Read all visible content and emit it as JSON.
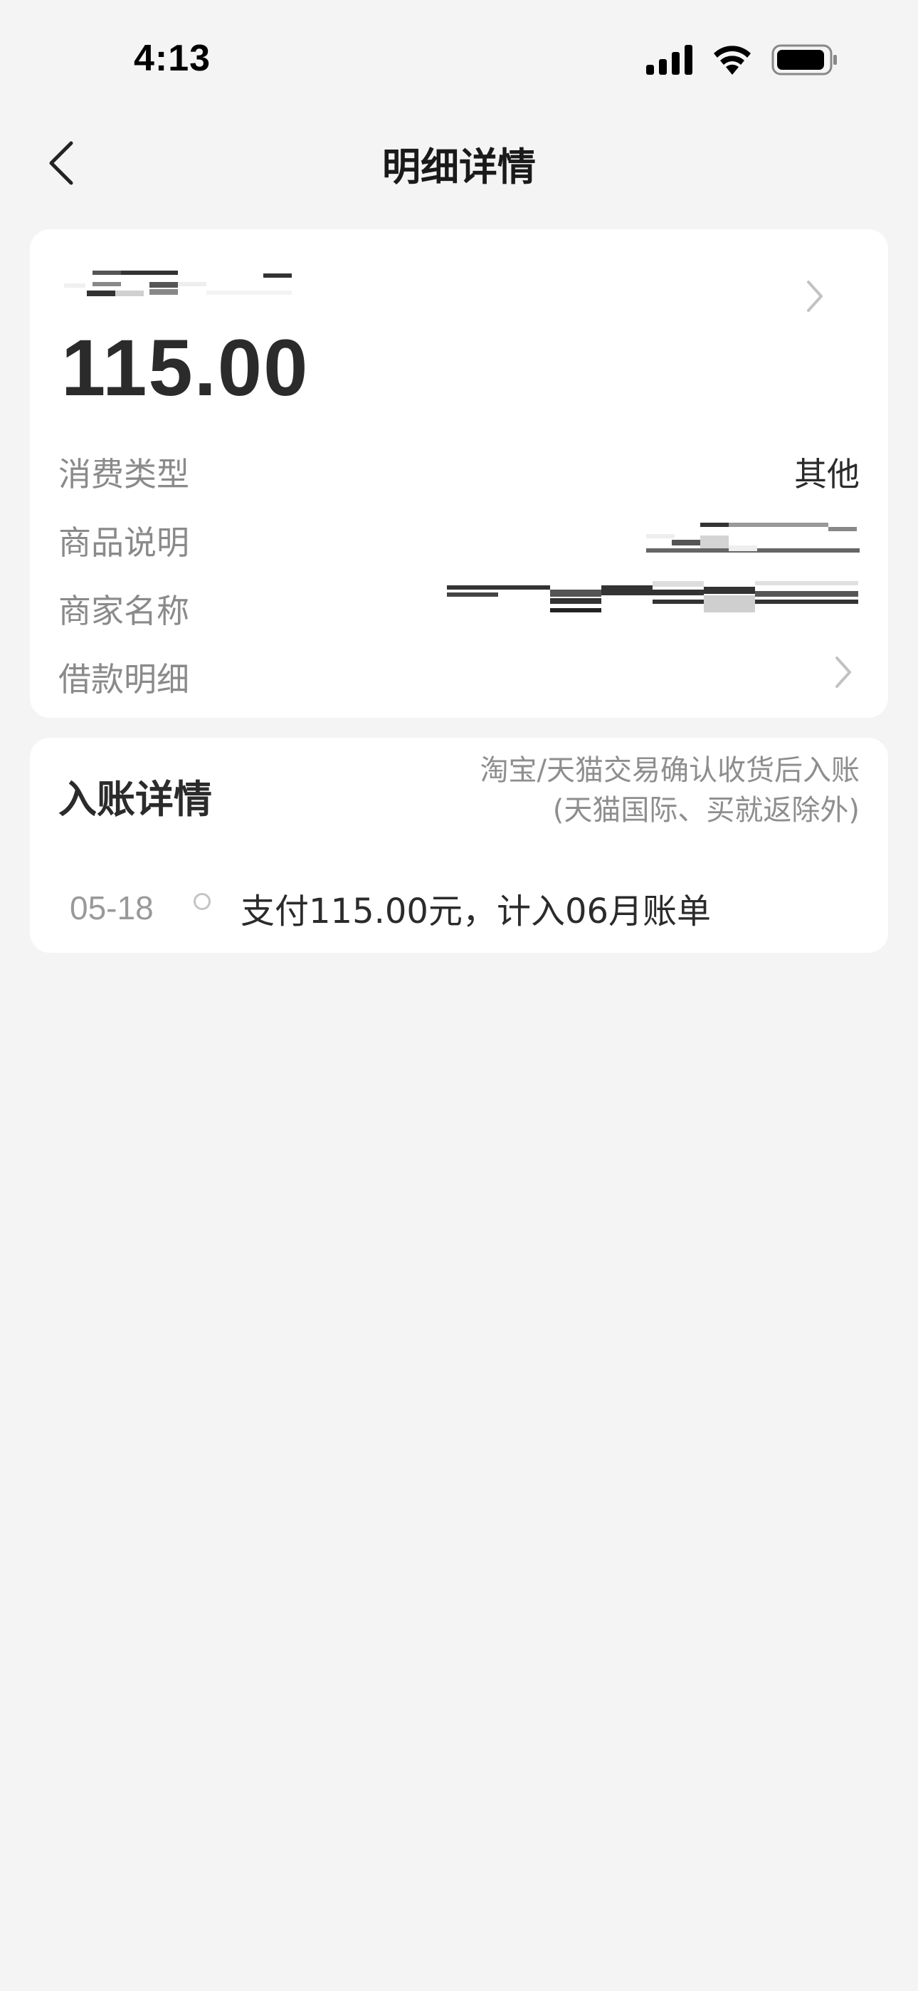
{
  "status_bar": {
    "time": "4:13",
    "icons": [
      "signal-icon",
      "wifi-icon",
      "battery-icon"
    ]
  },
  "nav": {
    "title": "明细详情",
    "back_icon": "chevron-left-icon"
  },
  "summary": {
    "amount": "115.00",
    "merchant_redacted": true
  },
  "info_rows": [
    {
      "label": "消费类型",
      "value": "其他"
    },
    {
      "label": "商品说明",
      "value": ""
    },
    {
      "label": "商家名称",
      "value": ""
    },
    {
      "label": "借款明细",
      "value": ""
    }
  ],
  "entry": {
    "title": "入账详情",
    "note_line1": "淘宝/天猫交易确认收货后入账",
    "note_line2": "(天猫国际、买就返除外)",
    "timeline": [
      {
        "date": "05-18",
        "text": "支付115.00元，计入06月账单"
      }
    ]
  },
  "colors": {
    "background": "#f4f4f4",
    "card": "#ffffff",
    "label": "#8a8a8a",
    "text": "#2b2b2b"
  }
}
